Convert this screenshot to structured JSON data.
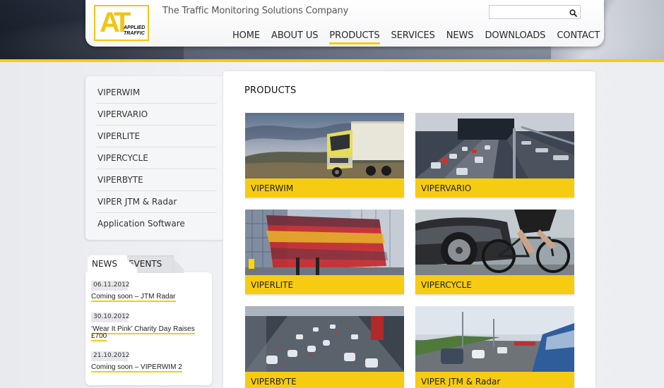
{
  "brand": {
    "logo_text": "AT",
    "logo_words": [
      "APPLIED",
      "TRAFFIC"
    ],
    "tagline": "The Traffic Monitoring Solutions Company"
  },
  "search": {
    "placeholder": "",
    "value": ""
  },
  "nav": {
    "items": [
      "HOME",
      "ABOUT US",
      "PRODUCTS",
      "SERVICES",
      "NEWS",
      "DOWNLOADS",
      "CONTACT"
    ],
    "active": "PRODUCTS"
  },
  "sidebar": {
    "items": [
      "VIPERWIM",
      "VIPERVARIO",
      "VIPERLITE",
      "VIPERCYCLE",
      "VIPERBYTE",
      "VIPER JTM & Radar",
      "Application Software"
    ]
  },
  "news_panel": {
    "tabs": [
      "NEWS",
      "EVENTS"
    ],
    "active_tab": "NEWS",
    "items": [
      {
        "date": "06.11.2012",
        "title": "Coming soon – JTM Radar"
      },
      {
        "date": "30.10.2012",
        "title_line1": "‘Wear It Pink’ Charity Day Raises",
        "title_line2": "£700"
      },
      {
        "date": "21.10.2012",
        "title": "Coming soon – VIPERWIM 2"
      }
    ]
  },
  "main": {
    "title": "PRODUCTS",
    "products": [
      "VIPERWIM",
      "VIPERVARIO",
      "VIPERLITE",
      "VIPERCYCLE",
      "VIPERBYTE",
      "VIPER JTM & Radar"
    ]
  },
  "colors": {
    "accent": "#f6cc12",
    "panel": "#ffffff",
    "background": "#eceef1"
  },
  "icons": {
    "search": "search-icon"
  }
}
